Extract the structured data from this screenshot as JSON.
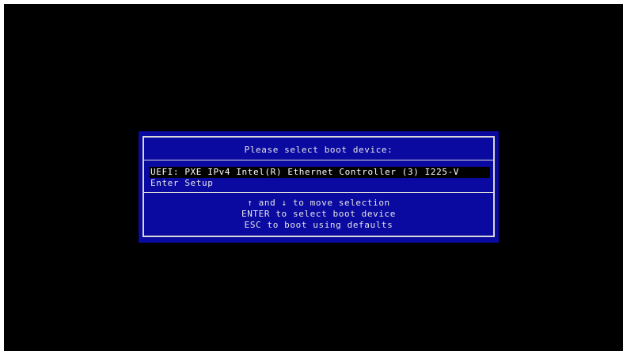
{
  "boot_menu": {
    "title": "Please select boot device:",
    "items": [
      {
        "label": "UEFI: PXE IPv4 Intel(R) Ethernet Controller (3) I225-V",
        "selected": true
      },
      {
        "label": "Enter Setup",
        "selected": false
      }
    ],
    "help": [
      "↑ and ↓ to move selection",
      "ENTER to select boot device",
      "ESC to boot using defaults"
    ]
  },
  "colors": {
    "screen_background": "#000000",
    "dialog_background": "#0a0aa0",
    "border": "#d8d8d8",
    "text": "#e6e6e6",
    "selection_background": "#000000"
  }
}
